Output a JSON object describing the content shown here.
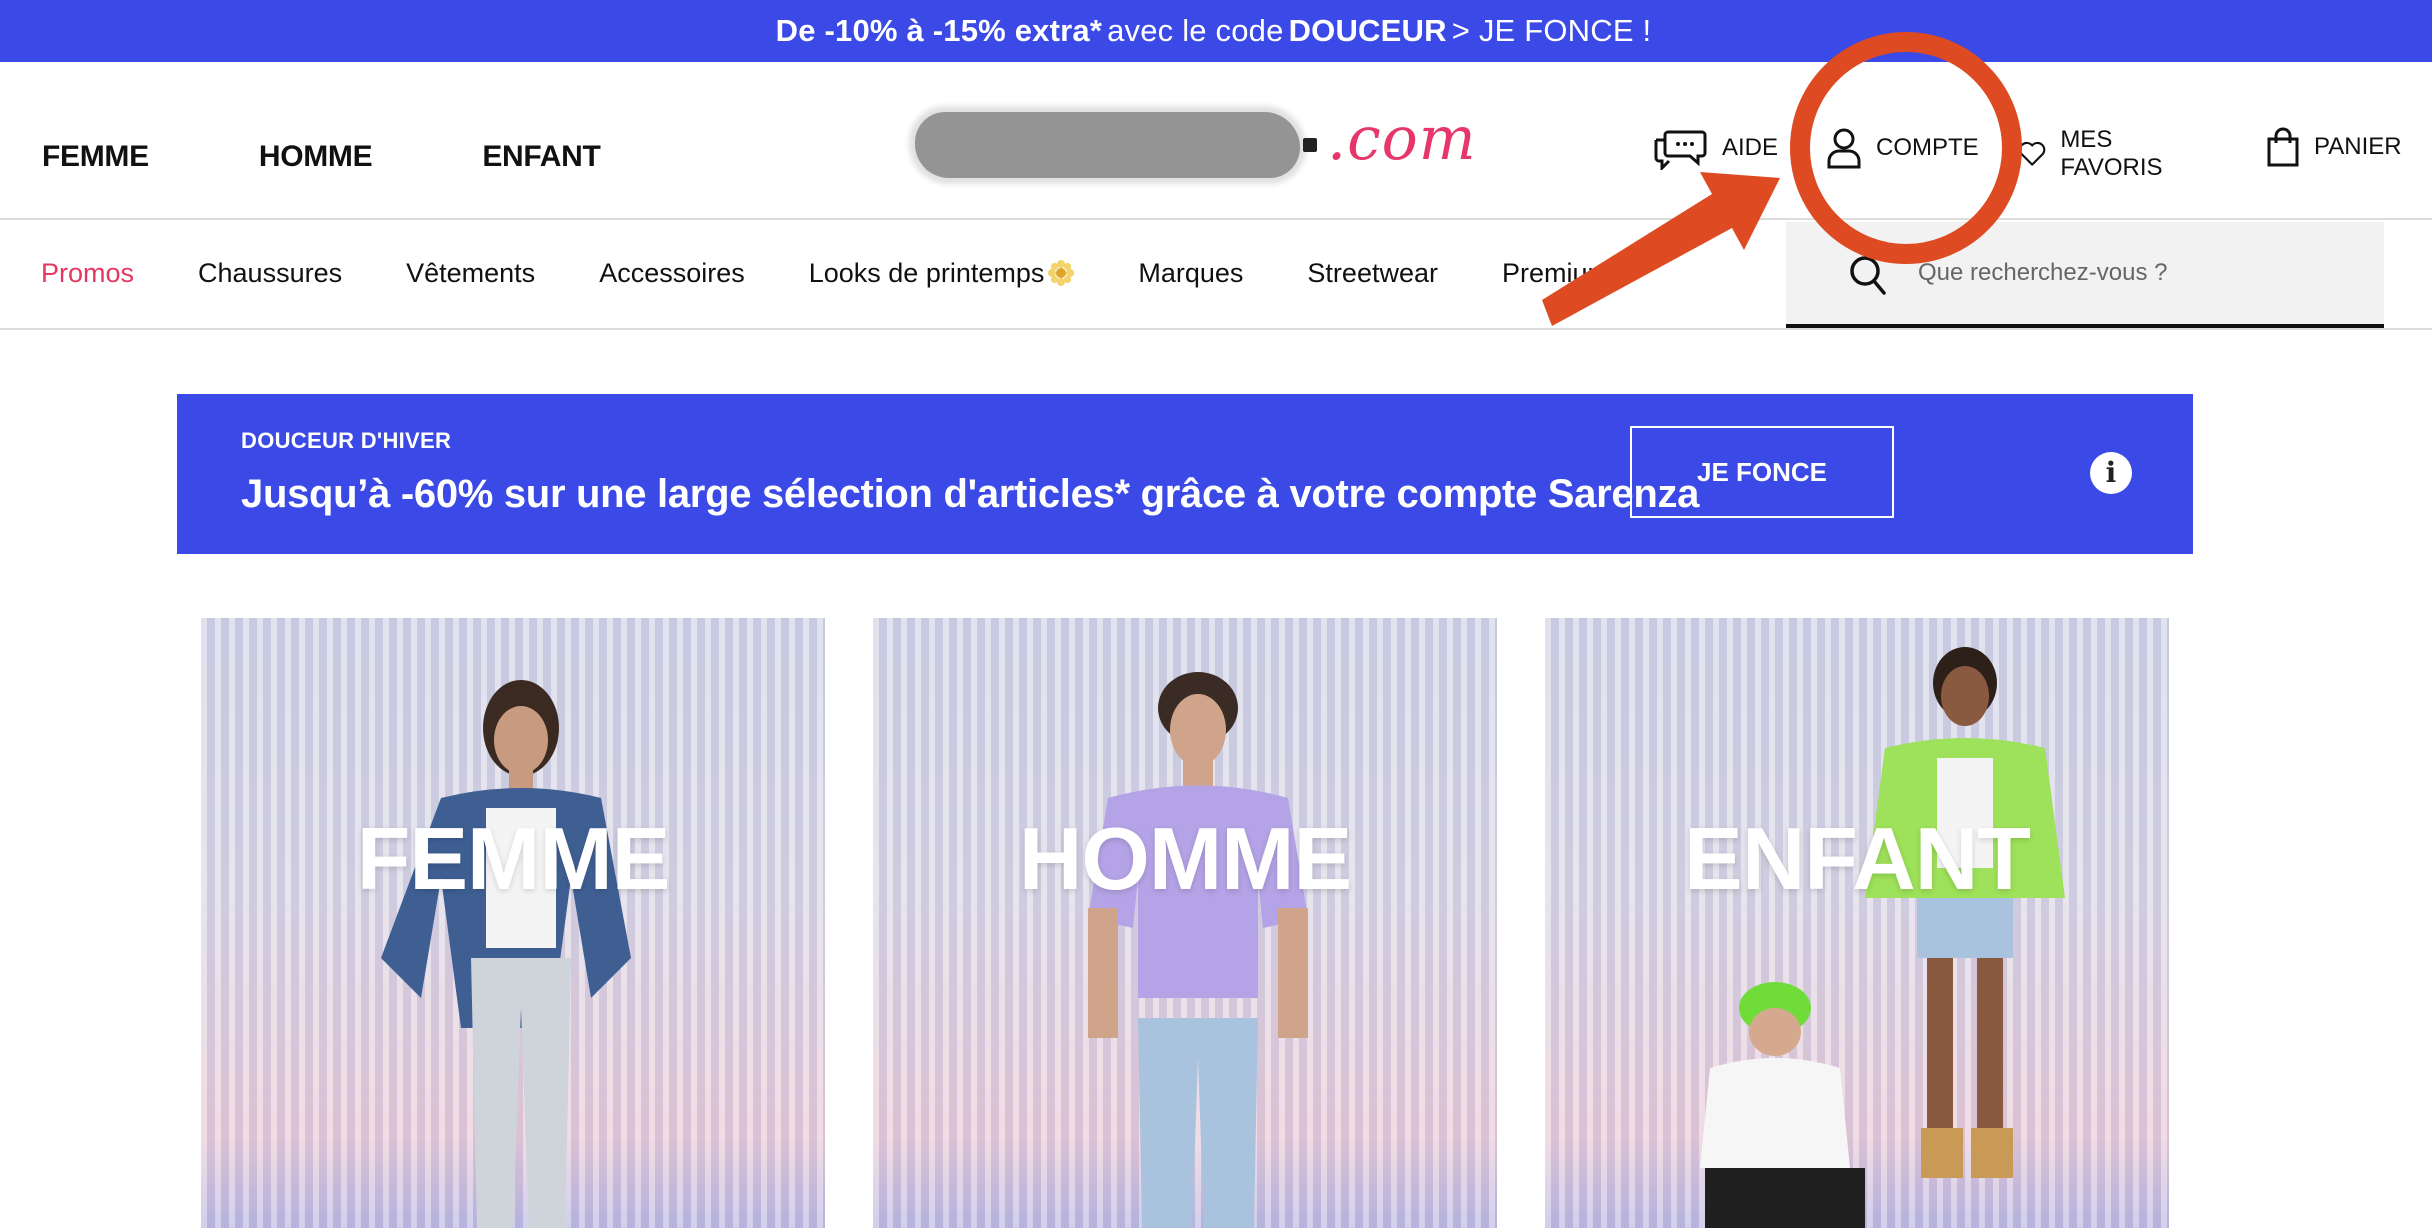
{
  "top_banner": {
    "part1": "De -10% à -15% extra*",
    "part2": "avec le code",
    "part3": "DOUCEUR",
    "part4": "> JE FONCE !"
  },
  "gender_nav": [
    "FEMME",
    "HOMME",
    "ENFANT"
  ],
  "logo": {
    "suffix": ".com"
  },
  "utilities": {
    "help": "AIDE",
    "account": "COMPTE",
    "favorites": "MES FAVORIS",
    "cart": "PANIER"
  },
  "categories": [
    "Promos",
    "Chaussures",
    "Vêtements",
    "Accessoires",
    "Looks de printemps",
    "Marques",
    "Streetwear",
    "Premium"
  ],
  "search": {
    "placeholder": "Que recherchez-vous ?"
  },
  "promo_banner": {
    "eyebrow": "DOUCEUR D'HIVER",
    "headline": "Jusqu’à -60% sur une large sélection d'articles* grâce à votre compte Sarenza",
    "cta": "JE FONCE"
  },
  "cards": [
    {
      "title": "FEMME"
    },
    {
      "title": "HOMME"
    },
    {
      "title": "ENFANT"
    }
  ],
  "colors": {
    "brand_blue": "#3b4ae6",
    "promo_red": "#e5375f",
    "logo_pink": "#e6366b",
    "annotation_orange": "#de4a22"
  }
}
